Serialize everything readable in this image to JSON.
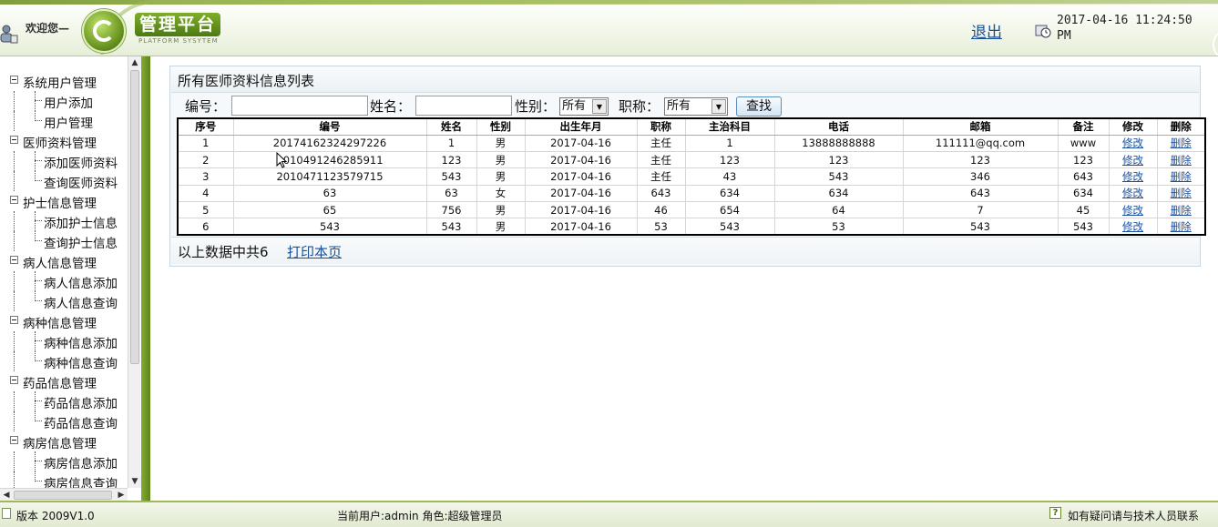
{
  "header": {
    "welcome": "欢迎您—",
    "logo_title": "管理平台",
    "logo_subtitle": "PLATFORM SYSYTEM",
    "logout": "退出",
    "datetime": "2017-04-16 11:24:50 PM"
  },
  "sidebar": {
    "groups": [
      {
        "label": "系统用户管理",
        "items": [
          "用户添加",
          "用户管理"
        ]
      },
      {
        "label": "医师资料管理",
        "items": [
          "添加医师资料",
          "查询医师资料"
        ]
      },
      {
        "label": "护士信息管理",
        "items": [
          "添加护士信息",
          "查询护士信息"
        ]
      },
      {
        "label": "病人信息管理",
        "items": [
          "病人信息添加",
          "病人信息查询"
        ]
      },
      {
        "label": "病种信息管理",
        "items": [
          "病种信息添加",
          "病种信息查询"
        ]
      },
      {
        "label": "药品信息管理",
        "items": [
          "药品信息添加",
          "药品信息查询"
        ]
      },
      {
        "label": "病房信息管理",
        "items": [
          "病房信息添加",
          "病房信息查询"
        ]
      }
    ]
  },
  "main": {
    "panel_title": "所有医师资料信息列表",
    "search": {
      "id_label": "编号：",
      "id_value": "",
      "name_label": "姓名：",
      "name_value": "",
      "gender_label": "性别：",
      "gender_value": "所有",
      "title_label": "职称：",
      "title_value": "所有",
      "search_button": "查找"
    },
    "table": {
      "columns": [
        "序号",
        "编号",
        "姓名",
        "性别",
        "出生年月",
        "职称",
        "主治科目",
        "电话",
        "邮箱",
        "备注",
        "修改",
        "删除"
      ],
      "rows": [
        [
          "1",
          "20174162324297226",
          "1",
          "男",
          "2017-04-16",
          "主任",
          "1",
          "13888888888",
          "111111@qq.com",
          "www",
          "修改",
          "删除"
        ],
        [
          "2",
          "2010491246285911",
          "123",
          "男",
          "2017-04-16",
          "主任",
          "123",
          "123",
          "123",
          "123",
          "修改",
          "删除"
        ],
        [
          "3",
          "2010471123579715",
          "543",
          "男",
          "2017-04-16",
          "主任",
          "43",
          "543",
          "346",
          "643",
          "修改",
          "删除"
        ],
        [
          "4",
          "63",
          "63",
          "女",
          "2017-04-16",
          "643",
          "634",
          "634",
          "643",
          "634",
          "修改",
          "删除"
        ],
        [
          "5",
          "65",
          "756",
          "男",
          "2017-04-16",
          "46",
          "654",
          "64",
          "7",
          "45",
          "修改",
          "删除"
        ],
        [
          "6",
          "543",
          "543",
          "男",
          "2017-04-16",
          "53",
          "543",
          "53",
          "543",
          "543",
          "修改",
          "删除"
        ]
      ]
    },
    "summary": "以上数据中共6",
    "print_link": "打印本页"
  },
  "footer": {
    "version": "版本 2009V1.0",
    "current_user": "当前用户:admin 角色:超级管理员",
    "help": "如有疑问请与技术人员联系"
  },
  "colors": {
    "accent_green": "#6c9722",
    "link_blue": "#1a4f9c"
  }
}
